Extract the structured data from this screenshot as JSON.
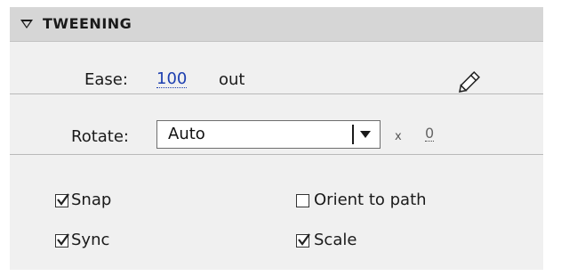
{
  "section": {
    "title": "TWEENING"
  },
  "ease": {
    "label": "Ease:",
    "value": "100",
    "direction": "out"
  },
  "rotate": {
    "label": "Rotate:",
    "selected": "Auto",
    "times_symbol": "x",
    "count": "0"
  },
  "options": [
    {
      "label": "Snap",
      "checked": true
    },
    {
      "label": "Orient to path",
      "checked": false
    },
    {
      "label": "Sync",
      "checked": true
    },
    {
      "label": "Scale",
      "checked": true
    }
  ],
  "colors": {
    "header_bg": "#d6d6d6",
    "panel_bg": "#f0f0f0",
    "link": "#1d3fb0"
  },
  "icons": {
    "edit": "pencil-icon",
    "collapse": "triangle-down-icon",
    "dropdown": "chevron-down-icon"
  }
}
